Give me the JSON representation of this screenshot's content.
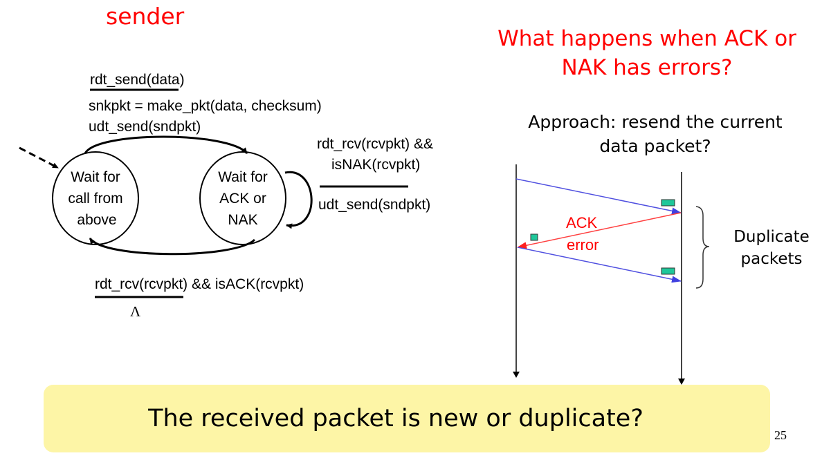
{
  "slide": {
    "sender_title": "sender",
    "question_lines": [
      "What happens when ACK or",
      "NAK has errors?"
    ],
    "page_number": "25",
    "callout": "The received packet is new or duplicate?"
  },
  "fsm": {
    "states": [
      {
        "lines": [
          "Wait for",
          "call from",
          "above"
        ]
      },
      {
        "lines": [
          "Wait for",
          "ACK or",
          "NAK"
        ]
      }
    ],
    "transitions": {
      "send": {
        "event": "rdt_send(data)",
        "actions": [
          "snkpkt = make_pkt(data, checksum)",
          "udt_send(sndpkt)"
        ]
      },
      "nak": {
        "event_lines": [
          "rdt_rcv(rcvpkt) &&",
          "isNAK(rcvpkt)"
        ],
        "action": "udt_send(sndpkt)"
      },
      "ack": {
        "event": "rdt_rcv(rcvpkt) && isACK(rcvpkt)",
        "action": "Λ"
      }
    }
  },
  "timeline": {
    "approach_lines": [
      "Approach: resend the current",
      "data packet?"
    ],
    "ack_error_lines": [
      "ACK",
      "error"
    ],
    "duplicate_lines": [
      "Duplicate",
      "packets"
    ],
    "colors": {
      "text_red": "#ff0000",
      "data_arrow": "#5050e0",
      "ack_arrow": "#ff4040",
      "packet": "#1fc79a",
      "callout_bg": "#fdf5a6"
    }
  }
}
